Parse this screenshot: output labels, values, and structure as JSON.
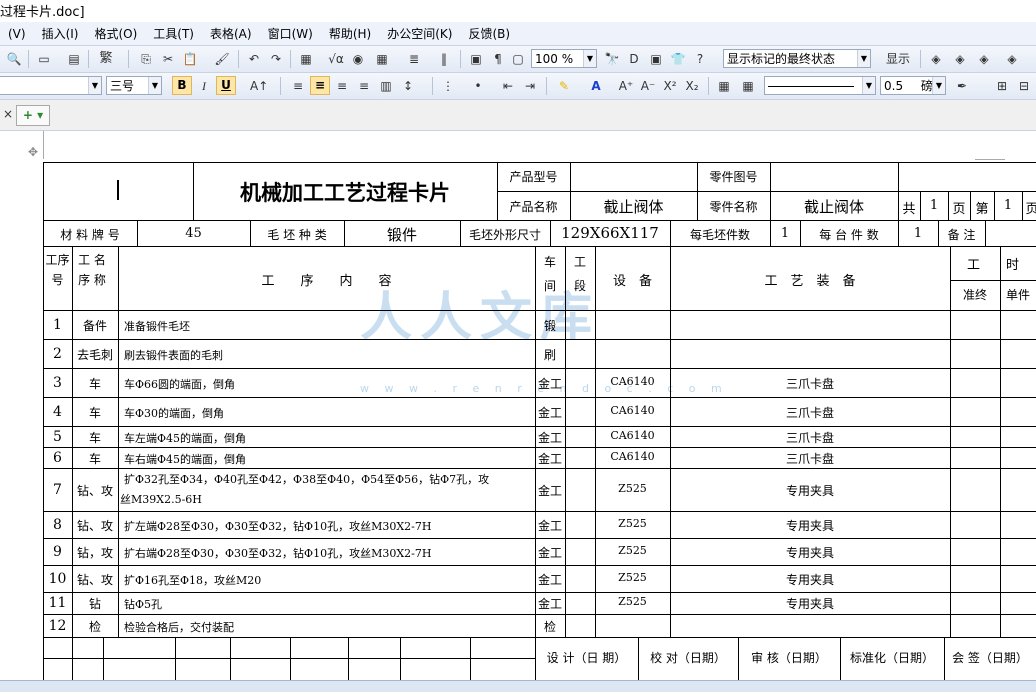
{
  "window": {
    "title": "过程卡片.doc]"
  },
  "menu": [
    "(V)",
    "插入(I)",
    "格式(O)",
    "工具(T)",
    "表格(A)",
    "窗口(W)",
    "帮助(H)",
    "办公空间(K)",
    "反馈(B)"
  ],
  "toolbar": {
    "simplified": "繁",
    "zoom": "100 %",
    "markup_state": "显示标记的最终状态",
    "show_label": "显示"
  },
  "format": {
    "font_size": "三号",
    "bold": "B",
    "italic": "I",
    "underline": "U",
    "line_width": "0.5",
    "line_unit": "磅"
  },
  "card": {
    "title": "机械加工工艺过程卡片",
    "product_model_label": "产品型号",
    "part_no_label": "零件图号",
    "product_name_label": "产品名称",
    "product_name": "截止阀体",
    "part_name_label": "零件名称",
    "part_name": "截止阀体",
    "total_label": "共",
    "total": "1",
    "page_label": "页",
    "no_label": "第",
    "no": "1",
    "page2_label": "页",
    "material_label": "材 料 牌 号",
    "material": "45",
    "blank_type_label": "毛 坯 种 类",
    "blank_type": "锻件",
    "blank_size_label": "毛坯外形尺寸",
    "blank_size": "129X66X117",
    "per_blank_label": "每毛坯件数",
    "per_blank": "1",
    "per_machine_label": "每 台 件 数",
    "per_machine": "1",
    "remark_label": "备 注",
    "h_no": "工序号",
    "h_name": "工 名 序 称",
    "h_content": "工　　序　　内　　容",
    "h_shop": "车间",
    "h_section": "工段",
    "h_equip": "设　备",
    "h_tool": "工　艺　装　备",
    "h_time": "工　　时",
    "h_prep": "准终",
    "h_unit": "单件",
    "sign": [
      "设 计（日 期）",
      "校 对（日期）",
      "审 核（日期）",
      "标准化（日期）",
      "会 签（日期）"
    ]
  },
  "rows": [
    {
      "no": "1",
      "name": "备件",
      "content": "准备锻件毛坯",
      "shop": "锻",
      "equip": "",
      "tool": ""
    },
    {
      "no": "2",
      "name": "去毛刺",
      "content": "刷去锻件表面的毛刺",
      "shop": "刷",
      "equip": "",
      "tool": ""
    },
    {
      "no": "3",
      "name": "车",
      "content": "车Φ66圆的端面，倒角",
      "shop": "金工",
      "equip": "CA6140",
      "tool": "三爪卡盘"
    },
    {
      "no": "4",
      "name": "车",
      "content": "车Φ30的端面，倒角",
      "shop": "金工",
      "equip": "CA6140",
      "tool": "三爪卡盘"
    },
    {
      "no": "5",
      "name": "车",
      "content": "车左端Φ45的端面，倒角",
      "shop": "金工",
      "equip": "CA6140",
      "tool": "三爪卡盘"
    },
    {
      "no": "6",
      "name": "车",
      "content": "车右端Φ45的端面，倒角",
      "shop": "金工",
      "equip": "CA6140",
      "tool": "三爪卡盘"
    },
    {
      "no": "7",
      "name": "钻、攻",
      "content": "扩Φ32孔至Φ34，Φ40孔至Φ42，Φ38至Φ40，Φ54至Φ56，钻Φ7孔，攻",
      "content2": "丝M39X2.5-6H",
      "shop": "金工",
      "equip": "Z525",
      "tool": "专用夹具"
    },
    {
      "no": "8",
      "name": "钻、攻",
      "content": "扩左端Φ28至Φ30，Φ30至Φ32，钻Φ10孔，攻丝M30X2-7H",
      "shop": "金工",
      "equip": "Z525",
      "tool": "专用夹具"
    },
    {
      "no": "9",
      "name": "钻，攻",
      "content": "扩右端Φ28至Φ30，Φ30至Φ32，钻Φ10孔，攻丝M30X2-7H",
      "shop": "金工",
      "equip": "Z525",
      "tool": "专用夹具"
    },
    {
      "no": "10",
      "name": "钻、攻",
      "content": "扩Φ16孔至Φ18，攻丝M20",
      "shop": "金工",
      "equip": "Z525",
      "tool": "专用夹具"
    },
    {
      "no": "11",
      "name": "钻",
      "content": "钻Φ5孔",
      "shop": "金工",
      "equip": "Z525",
      "tool": "专用夹具"
    },
    {
      "no": "12",
      "name": "检",
      "content": "检验合格后，交付装配",
      "shop": "检",
      "equip": "",
      "tool": ""
    }
  ],
  "watermark": {
    "text": "人人文库",
    "url": "w w w . r e n r e n d o c . c o m"
  }
}
